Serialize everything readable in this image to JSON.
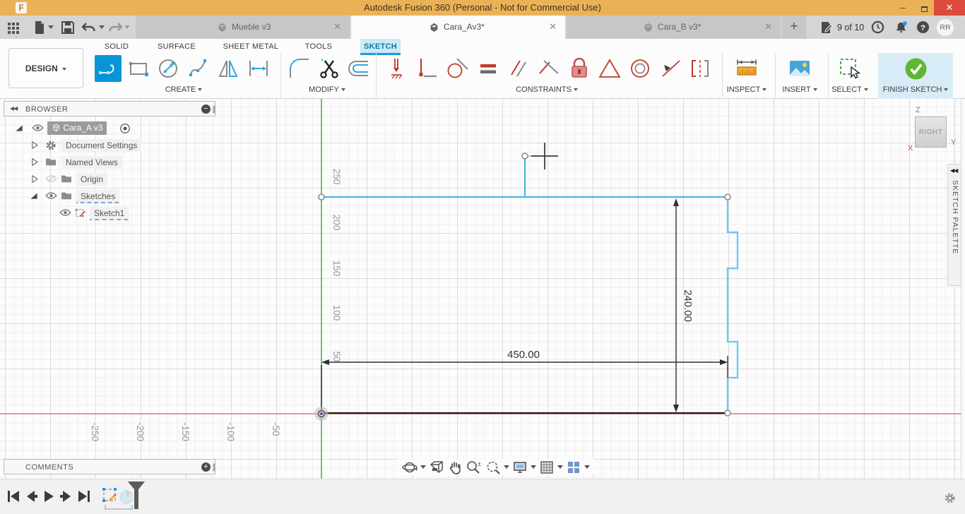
{
  "titlebar": {
    "title": "Autodesk Fusion 360 (Personal - Not for Commercial Use)",
    "logo_letter": "F"
  },
  "document_tabs": [
    {
      "label": "Mueble v3",
      "active": false
    },
    {
      "label": "Cara_Av3*",
      "active": true
    },
    {
      "label": "Cara_B v3*",
      "active": false
    }
  ],
  "quick_access": {
    "job_status": "9 of 10",
    "avatar_initials": "RR"
  },
  "ribbon": {
    "design_label": "DESIGN",
    "tabs": [
      "SOLID",
      "SURFACE",
      "SHEET METAL",
      "TOOLS",
      "SKETCH"
    ],
    "active_tab": "SKETCH",
    "groups": {
      "create": "CREATE",
      "modify": "MODIFY",
      "constraints": "CONSTRAINTS",
      "inspect": "INSPECT",
      "insert": "INSERT",
      "select": "SELECT",
      "finish": "FINISH SKETCH"
    }
  },
  "browser": {
    "header": "BROWSER",
    "root_label": "Cara_A v3",
    "rows": [
      {
        "label": "Document Settings"
      },
      {
        "label": "Named Views"
      },
      {
        "label": "Origin"
      },
      {
        "label": "Sketches"
      },
      {
        "label": "Sketch1"
      }
    ]
  },
  "sketch": {
    "dim_width": "450.00",
    "dim_height": "240.00",
    "x_axis_labels": [
      "-250",
      "-200",
      "-150",
      "-100",
      "-50"
    ],
    "y_axis_labels": [
      "250",
      "200",
      "150",
      "100",
      "50"
    ]
  },
  "viewcube": {
    "face": "RIGHT",
    "axis_x": "X",
    "axis_y": "Y",
    "axis_z": "Z"
  },
  "sketch_palette": {
    "label": "SKETCH PALETTE"
  },
  "comments": {
    "header": "COMMENTS"
  },
  "glyphs": {
    "close": "✕",
    "minimize": "–",
    "plus": "+",
    "minus": "−",
    "grip": "∥",
    "collapse_left": "◀◀",
    "tab_close": "✕"
  },
  "colors": {
    "accent_blue": "#0696d7",
    "tab_highlight": "#cde9f6",
    "title_amber": "#eab257",
    "finish_green": "#5fb832",
    "constraint_red": "#c0392b",
    "axis_green": "#55b055",
    "axis_red": "#e06666",
    "sketch_blue": "#4db3e6"
  }
}
